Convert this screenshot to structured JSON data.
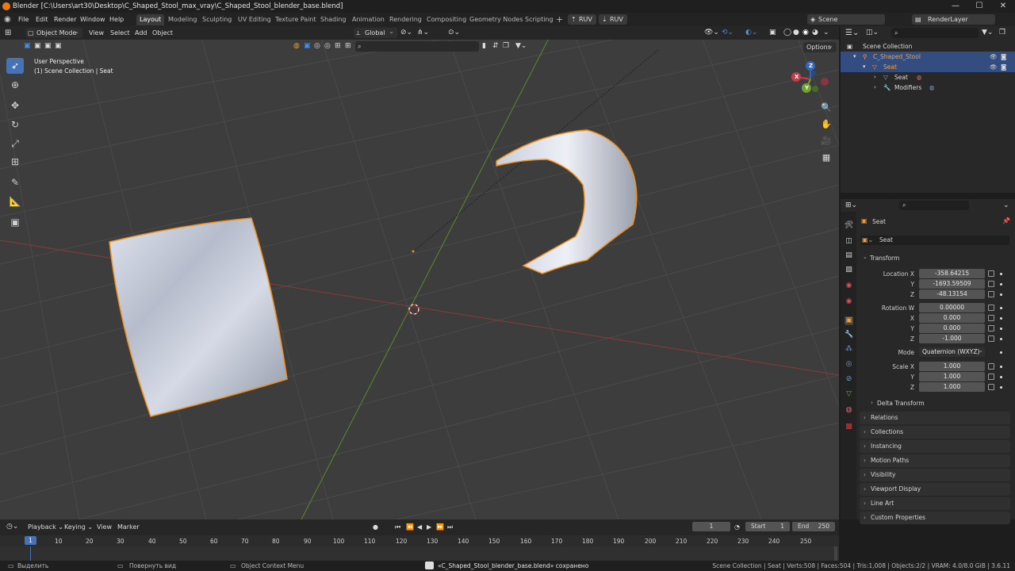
{
  "window": {
    "title": "Blender [C:\\Users\\art30\\Desktop\\C_Shaped_Stool_max_vray\\C_Shaped_Stool_blender_base.blend]",
    "minimize": "—",
    "maximize": "☐",
    "close": "✕"
  },
  "menus": [
    "File",
    "Edit",
    "Render",
    "Window",
    "Help"
  ],
  "workspaces": [
    "Layout",
    "Modeling",
    "Sculpting",
    "UV Editing",
    "Texture Paint",
    "Shading",
    "Animation",
    "Rendering",
    "Compositing",
    "Geometry Nodes",
    "Scripting"
  ],
  "ruv_buttons": [
    "RUV",
    "RUV"
  ],
  "scene": {
    "label": "Scene",
    "render_layer": "RenderLayer"
  },
  "viewport_header": {
    "mode": "Object Mode",
    "menus": [
      "View",
      "Select",
      "Add",
      "Object"
    ],
    "transform": "Global",
    "options": "Options"
  },
  "viewport_overlay": {
    "line1": "User Perspective",
    "line2": "(1) Scene Collection | Seat"
  },
  "gizmo": {
    "x": "X",
    "y": "Y",
    "z": "Z"
  },
  "outliner": {
    "root": "Scene Collection",
    "rows": [
      {
        "label": "C_Shaped_Stool"
      },
      {
        "label": "Seat"
      },
      {
        "label": "Seat"
      },
      {
        "label": "Modifiers"
      }
    ]
  },
  "properties": {
    "object_name": "Seat",
    "datablock": "Seat",
    "transform_title": "Transform",
    "location": {
      "label": "Location X",
      "x": "-358.64215",
      "y_label": "Y",
      "y": "-1693.59509",
      "z_label": "Z",
      "z": "-48.13154"
    },
    "rotation": {
      "label": "Rotation W",
      "w": "0.00000",
      "x_label": "X",
      "x": "0.000",
      "y_label": "Y",
      "y": "0.000",
      "z_label": "Z",
      "z": "-1.000"
    },
    "mode": {
      "label": "Mode",
      "value": "Quaternion (WXYZ)"
    },
    "scale": {
      "label": "Scale X",
      "x": "1.000",
      "y_label": "Y",
      "y": "1.000",
      "z_label": "Z",
      "z": "1.000"
    },
    "delta": "Delta Transform",
    "panels": [
      "Relations",
      "Collections",
      "Instancing",
      "Motion Paths",
      "Visibility",
      "Viewport Display",
      "Line Art",
      "Custom Properties"
    ]
  },
  "timeline": {
    "menus": [
      "Playback",
      "Keying",
      "View",
      "Marker"
    ],
    "current_frame": "1",
    "start_label": "Start",
    "start": "1",
    "end_label": "End",
    "end": "250",
    "ticks": [
      "10",
      "20",
      "30",
      "40",
      "50",
      "60",
      "70",
      "80",
      "90",
      "100",
      "110",
      "120",
      "130",
      "140",
      "150",
      "160",
      "170",
      "180",
      "190",
      "200",
      "210",
      "220",
      "230",
      "240",
      "250"
    ],
    "playhead": "1"
  },
  "status": {
    "left1": "Выделить",
    "left2": "Повернуть вид",
    "left3": "Object Context Menu",
    "message": "«C_Shaped_Stool_blender_base.blend» сохранено",
    "right": "Scene Collection | Seat | Verts:508 | Faces:504 | Tris:1,008 | Objects:2/2 | VRAM: 4.0/8.0 GiB | 3.6.11"
  },
  "colors": {
    "accent": "#4772b3",
    "selection": "#f0901c",
    "grid_x": "#b33a3a",
    "grid_y": "#6b9a2a"
  }
}
